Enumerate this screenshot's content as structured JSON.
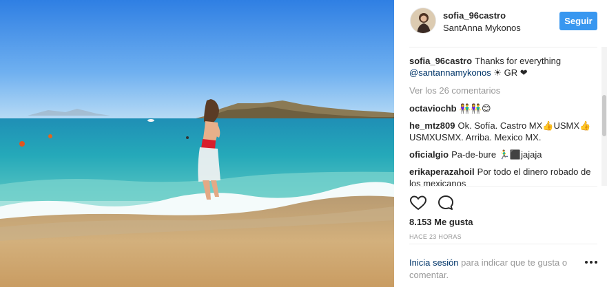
{
  "post": {
    "username": "sofia_96castro",
    "location": "SantAnna Mykonos",
    "follow_label": "Seguir",
    "caption": {
      "user": "sofia_96castro",
      "text": "Thanks for everything",
      "mention": "@santannamykonos",
      "suffix": "☀ GR ❤"
    },
    "view_all_comments": "Ver los 26 comentarios",
    "comments": [
      {
        "user": "octaviochb",
        "text": "👫👫😊"
      },
      {
        "user": "he_mtz809",
        "text": "Ok. Sofía. Castro MX👍USMX👍USMXUSMX. Arriba. Mexico MX."
      },
      {
        "user": "oficialgio",
        "text": "Pa-de-bure 🏃‍♂️⬛jajaja"
      },
      {
        "user": "erikaperazahoil",
        "text": "Por todo el dinero robado de los mexicanos"
      }
    ],
    "likes": "8.153 Me gusta",
    "time": "HACE 23 HORAS",
    "login_prompt": {
      "link": "Inicia sesión",
      "text": "para indicar que te gusta o comentar."
    }
  },
  "icons": {
    "like": "heart-outline-icon",
    "comment": "speech-bubble-icon",
    "more": "ellipsis-icon"
  },
  "colors": {
    "follow_button": "#3897f0",
    "link": "#003569",
    "muted": "#999999",
    "text": "#262626"
  }
}
